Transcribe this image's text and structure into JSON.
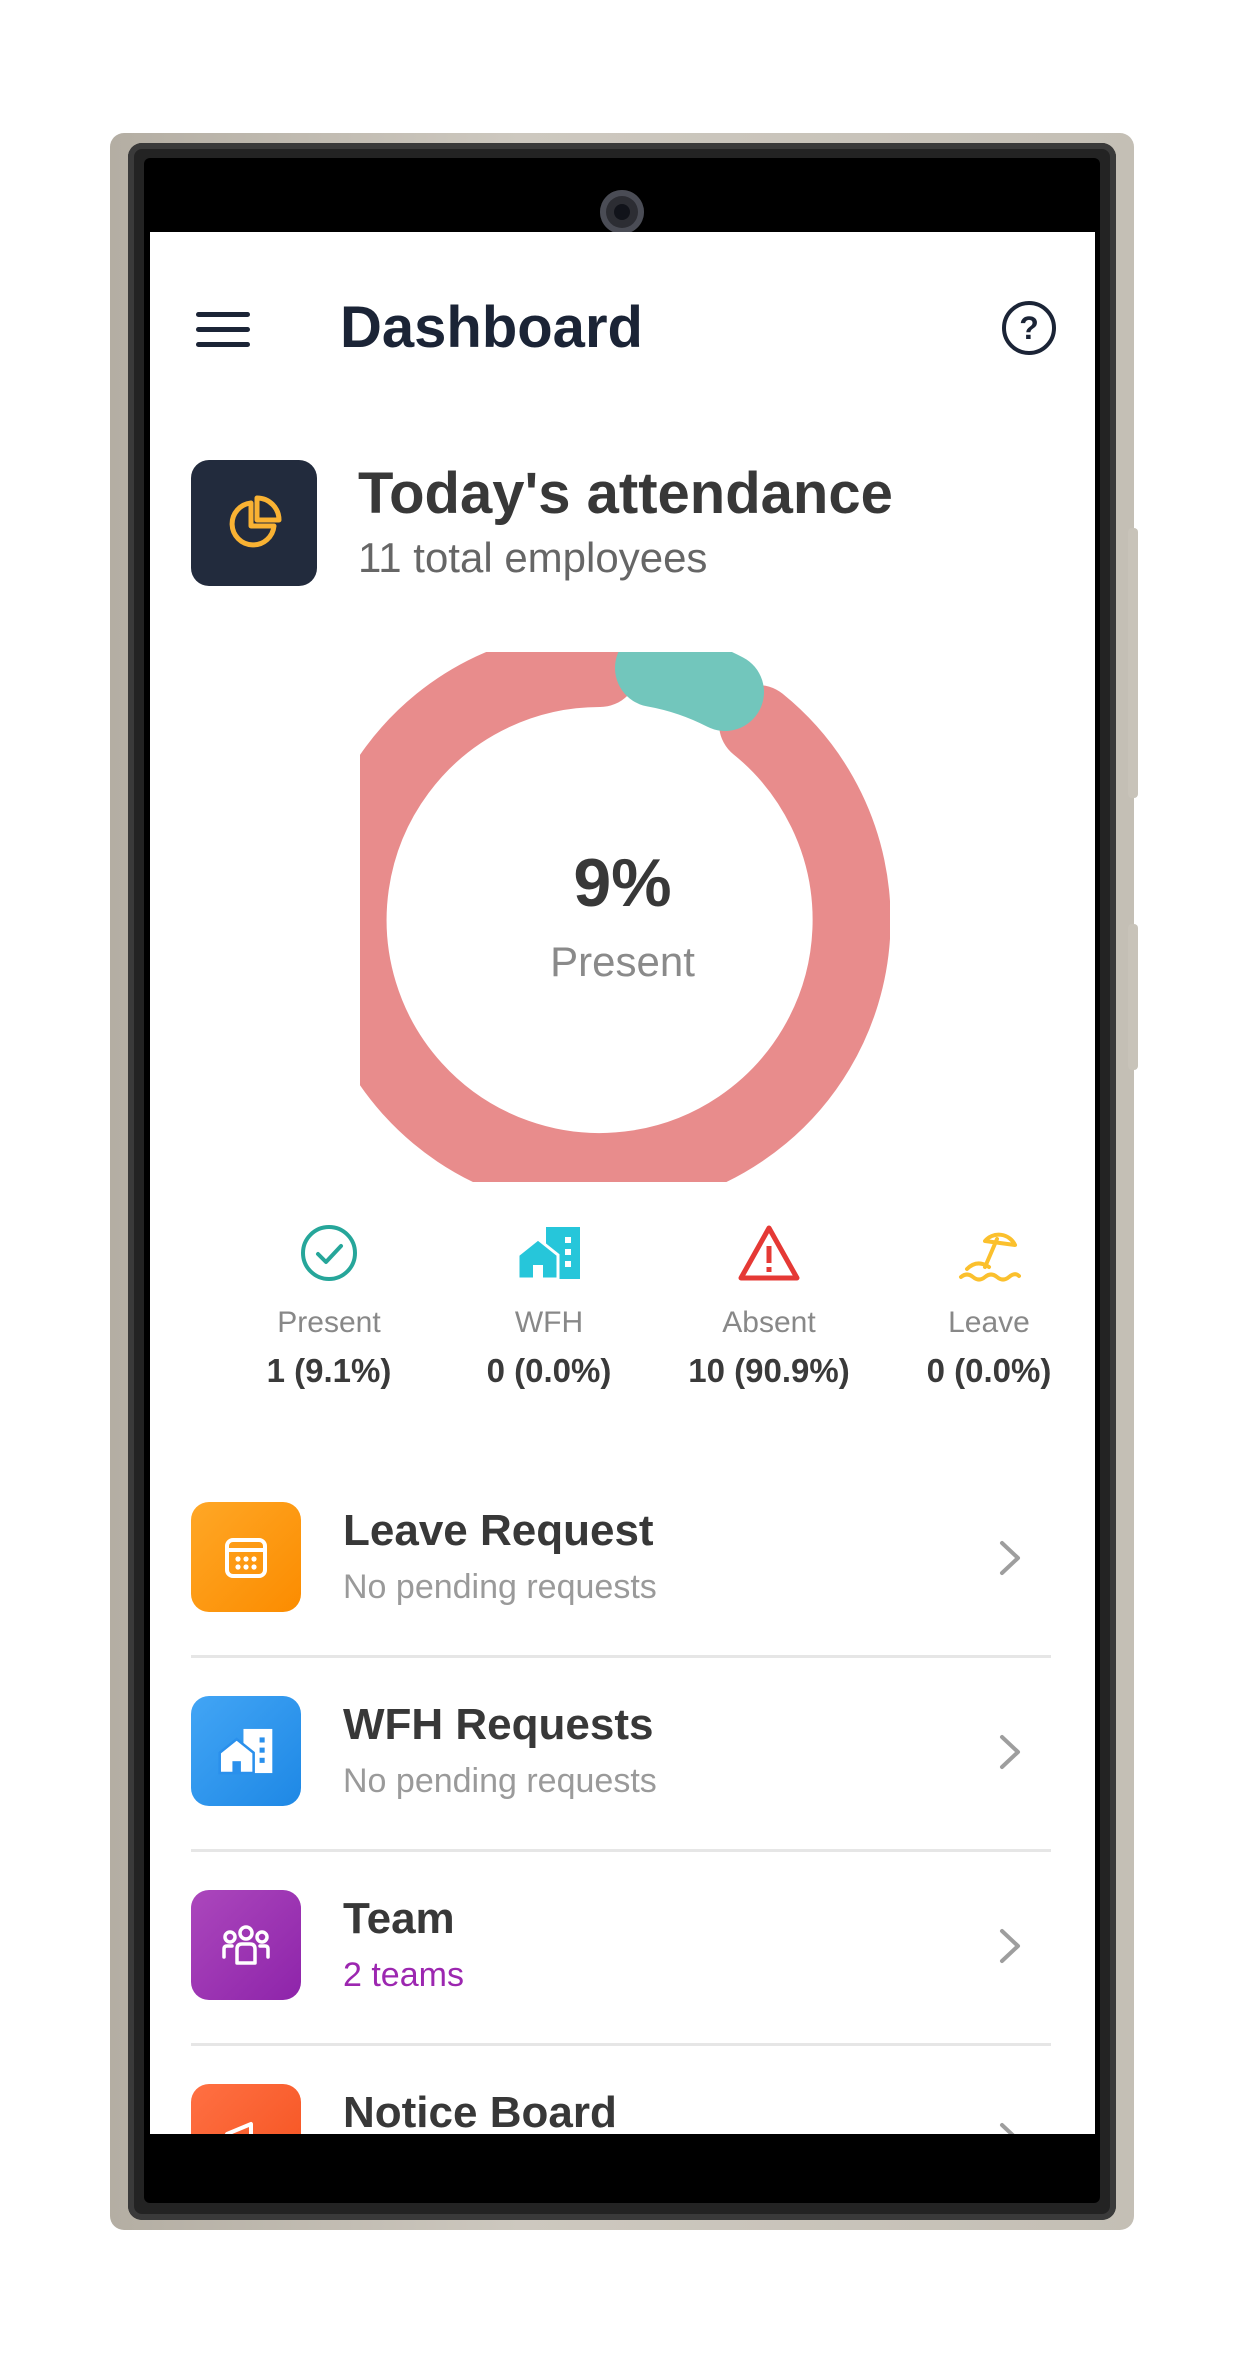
{
  "header": {
    "title": "Dashboard"
  },
  "attendance": {
    "title": "Today's attendance",
    "subtitle": "11 total employees",
    "center_percent": "9%",
    "center_label": "Present"
  },
  "stats": [
    {
      "label": "Present",
      "value": "1 (9.1%)",
      "icon": "check-circle-icon",
      "color": "#26a69a"
    },
    {
      "label": "WFH",
      "value": "0 (0.0%)",
      "icon": "home-work-icon",
      "color": "#26c6da"
    },
    {
      "label": "Absent",
      "value": "10 (90.9%)",
      "icon": "warning-icon",
      "color": "#e53935"
    },
    {
      "label": "Leave",
      "value": "0 (0.0%)",
      "icon": "beach-umbrella-icon",
      "color": "#fbc02d"
    }
  ],
  "menu": [
    {
      "title": "Leave Request",
      "subtitle": "No pending requests",
      "icon": "calendar-icon",
      "color": "#ff9800"
    },
    {
      "title": "WFH Requests",
      "subtitle": "No pending requests",
      "icon": "home-work-icon",
      "color": "#2196f3"
    },
    {
      "title": "Team",
      "subtitle": "2 teams",
      "icon": "group-icon",
      "color": "#9c27b0",
      "subtitle_color": "#9c27b0"
    },
    {
      "title": "Notice Board",
      "subtitle": "",
      "icon": "megaphone-icon",
      "color": "#ff5722"
    }
  ],
  "donut_colors": {
    "absent": "#e88c8c",
    "present": "#72c6bc"
  }
}
